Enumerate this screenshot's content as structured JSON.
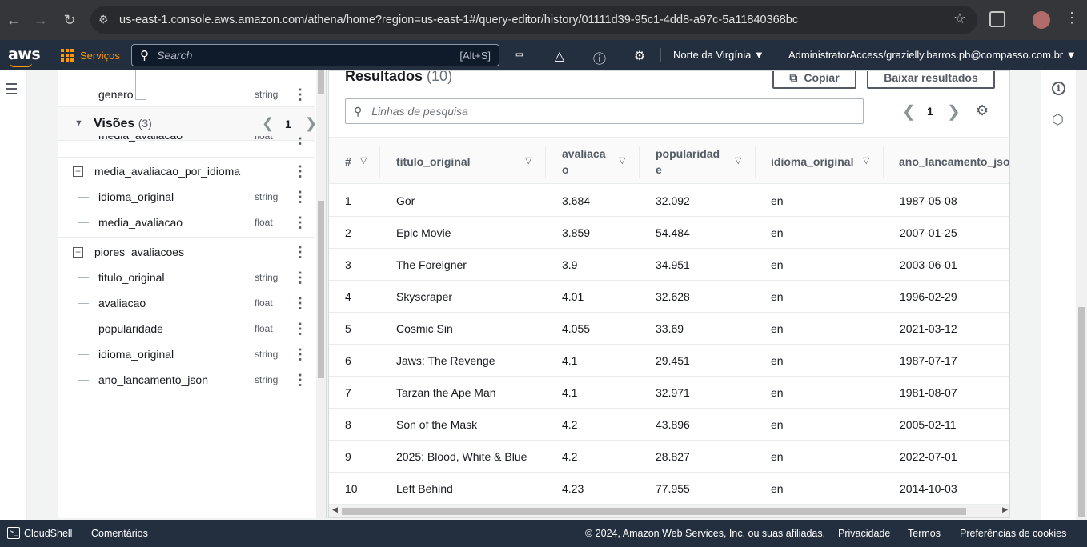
{
  "browser": {
    "url": "us-east-1.console.aws.amazon.com/athena/home?region=us-east-1#/query-editor/history/01111d39-95c1-4dd8-a97c-5a11840368bc"
  },
  "awsnav": {
    "logo": "aws",
    "services": "Serviços",
    "search_placeholder": "Search",
    "search_shortcut": "[Alt+S]",
    "region": "Norte da Virgínia ▼",
    "account": "AdministratorAccess/grazielly.barros.pb@compasso.com.br ▼"
  },
  "schema": {
    "top_item": {
      "label": "genero",
      "type": "string"
    },
    "views_header": {
      "title": "Visões",
      "count": "(3)",
      "page": "1"
    },
    "partial_item": {
      "label": "media_avaliacao",
      "type": "float"
    },
    "groups": [
      {
        "name": "media_avaliacao_por_idioma",
        "columns": [
          {
            "label": "idioma_original",
            "type": "string"
          },
          {
            "label": "media_avaliacao",
            "type": "float"
          }
        ]
      },
      {
        "name": "piores_avaliacoes",
        "columns": [
          {
            "label": "titulo_original",
            "type": "string"
          },
          {
            "label": "avaliacao",
            "type": "float"
          },
          {
            "label": "popularidade",
            "type": "float"
          },
          {
            "label": "idioma_original",
            "type": "string"
          },
          {
            "label": "ano_lancamento_json",
            "type": "string"
          }
        ]
      }
    ]
  },
  "results": {
    "title": "Resultados",
    "count": "(10)",
    "copy_label": "Copiar",
    "download_label": "Baixar resultados",
    "search_placeholder": "Linhas de pesquisa",
    "page": "1",
    "columns": [
      "#",
      "titulo_original",
      "avaliaca\no",
      "popularidad\ne",
      "idioma_original",
      "ano_lancamento_json"
    ],
    "rows": [
      [
        "1",
        "Gor",
        "3.684",
        "32.092",
        "en",
        "1987-05-08"
      ],
      [
        "2",
        "Epic Movie",
        "3.859",
        "54.484",
        "en",
        "2007-01-25"
      ],
      [
        "3",
        "The Foreigner",
        "3.9",
        "34.951",
        "en",
        "2003-06-01"
      ],
      [
        "4",
        "Skyscraper",
        "4.01",
        "32.628",
        "en",
        "1996-02-29"
      ],
      [
        "5",
        "Cosmic Sin",
        "4.055",
        "33.69",
        "en",
        "2021-03-12"
      ],
      [
        "6",
        "Jaws: The Revenge",
        "4.1",
        "29.451",
        "en",
        "1987-07-17"
      ],
      [
        "7",
        "Tarzan the Ape Man",
        "4.1",
        "32.971",
        "en",
        "1981-08-07"
      ],
      [
        "8",
        "Son of the Mask",
        "4.2",
        "43.896",
        "en",
        "2005-02-11"
      ],
      [
        "9",
        "2025: Blood, White & Blue",
        "4.2",
        "28.827",
        "en",
        "2022-07-01"
      ],
      [
        "10",
        "Left Behind",
        "4.23",
        "77.955",
        "en",
        "2014-10-03"
      ]
    ]
  },
  "footer": {
    "cloudshell": "CloudShell",
    "feedback": "Comentários",
    "copyright": "© 2024, Amazon Web Services, Inc. ou suas afiliadas.",
    "privacy": "Privacidade",
    "terms": "Termos",
    "cookies": "Preferências de cookies"
  }
}
